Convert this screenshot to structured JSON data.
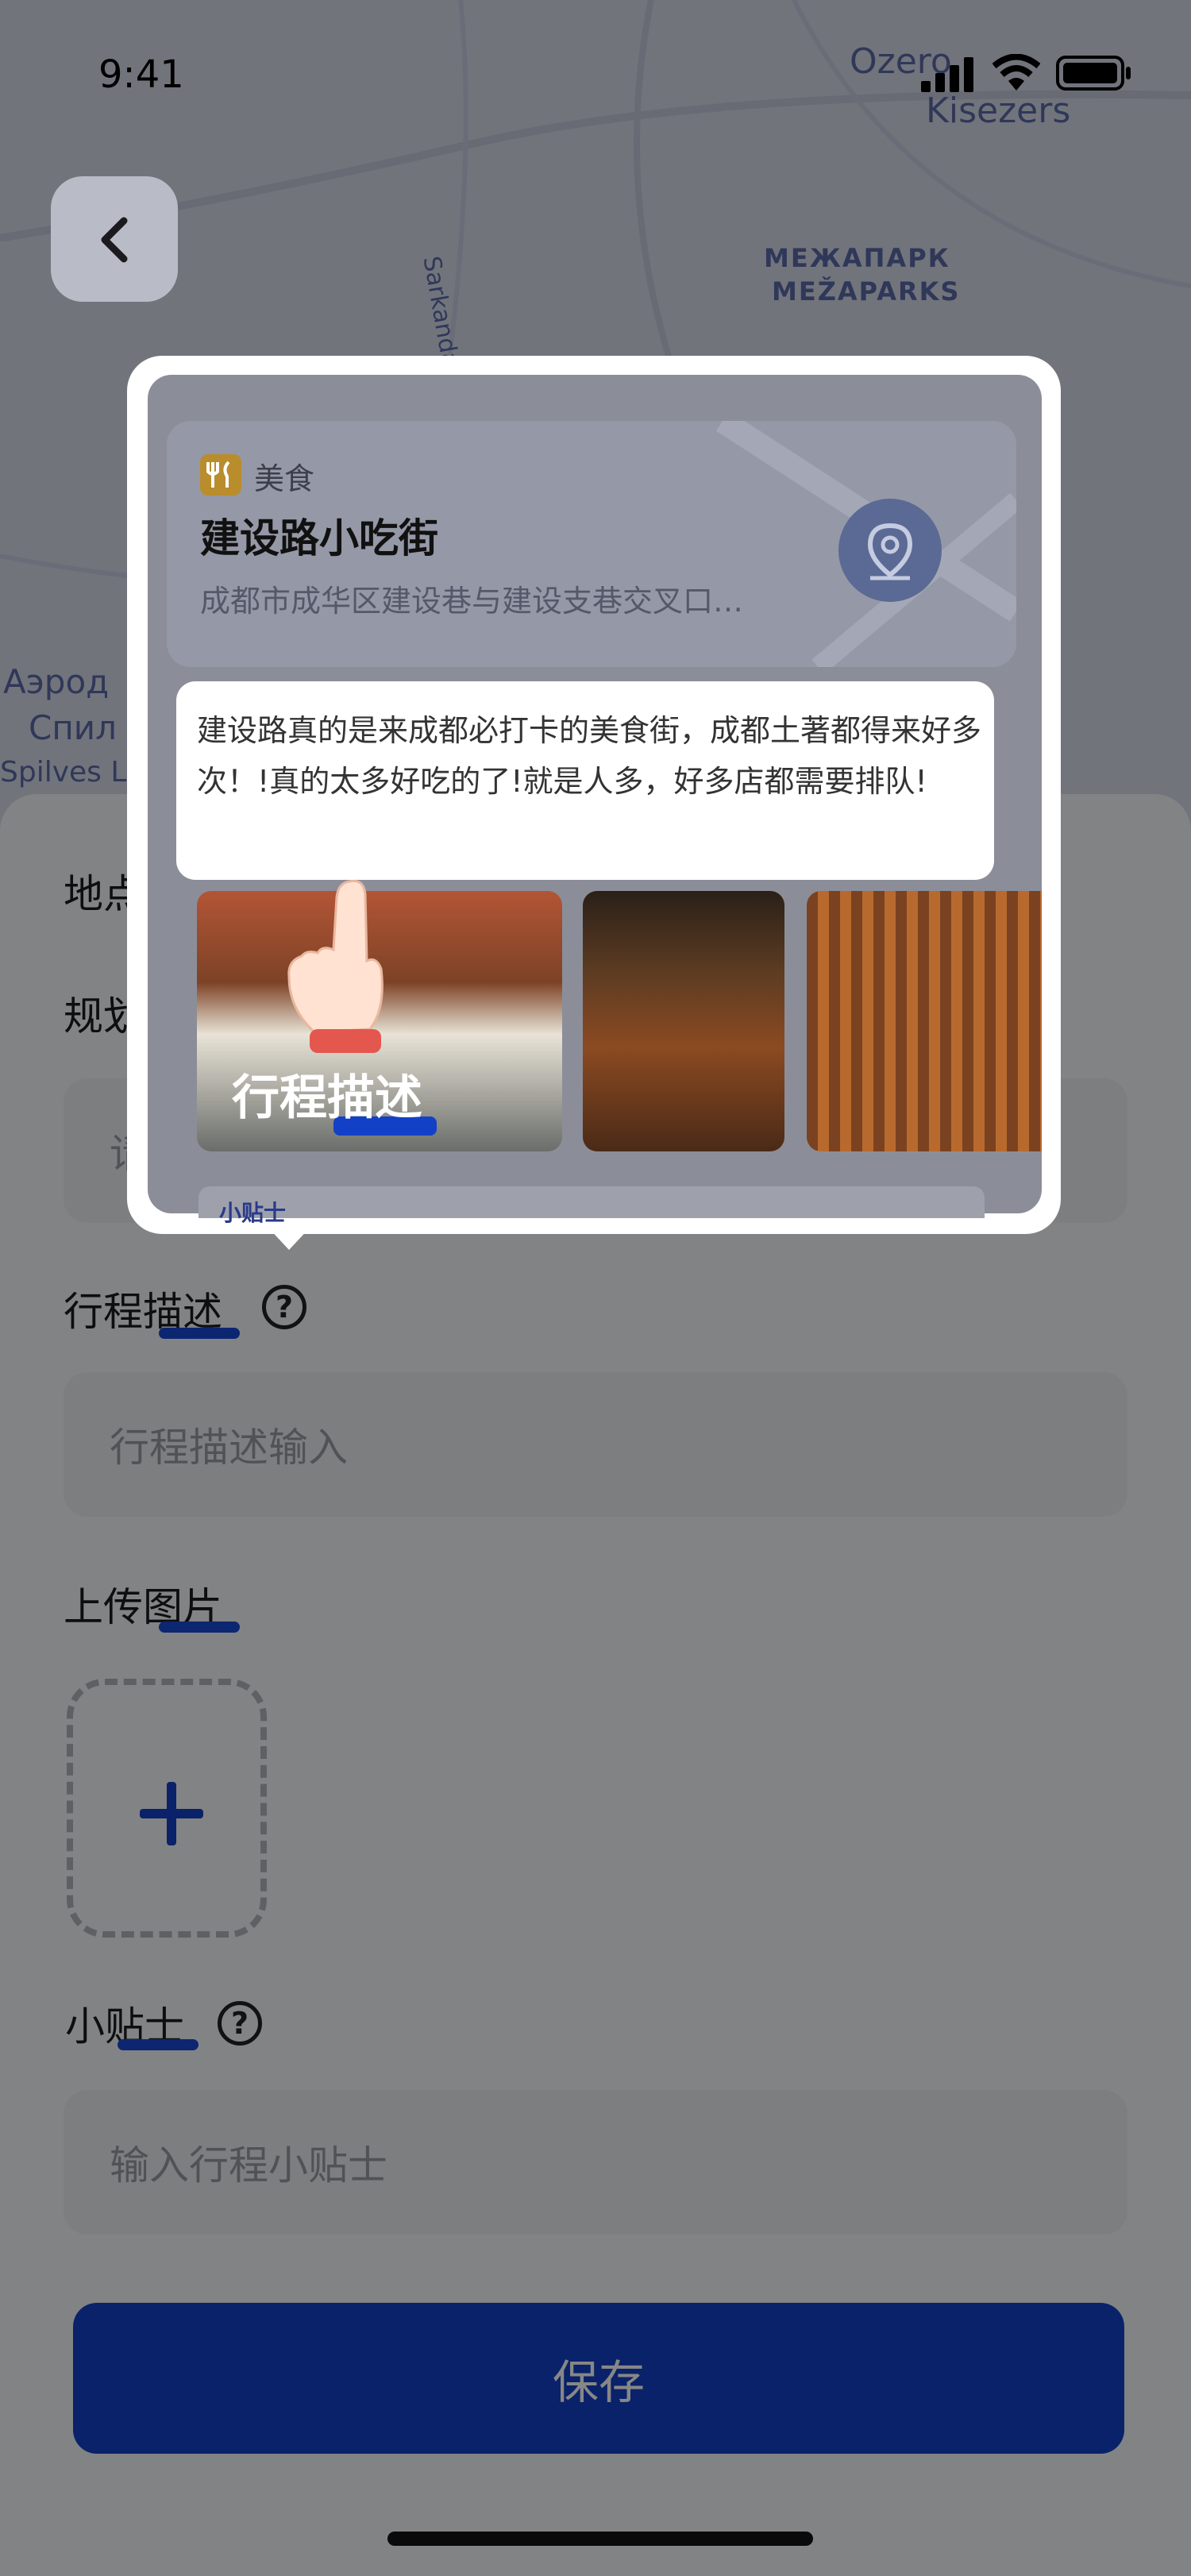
{
  "status": {
    "time": "9:41"
  },
  "map": {
    "labels": [
      "Ozero",
      "Kisezers",
      "МЕЖАПАРК",
      "MEŽAPARKS",
      "Sarkandaugava",
      "Аэрод",
      "Спил",
      "Spilves L"
    ]
  },
  "form": {
    "location_label": "地点",
    "plan_label": "规划",
    "plan_placeholder": "请",
    "description_label": "行程描述",
    "description_placeholder": "行程描述输入",
    "upload_label": "上传图片",
    "tips_label": "小贴士",
    "tips_placeholder": "输入行程小贴士",
    "save_button": "保存"
  },
  "popup": {
    "poi": {
      "category": "美食",
      "name": "建设路小吃街",
      "address": "成都市成华区建设巷与建设支巷交叉口…"
    },
    "tooltip_text": "建设路真的是来成都必打卡的美食街，成都土著都得来好多次！!真的太多好吃的了!就是人多，好多店都需要排队!",
    "highlight_label": "行程描述",
    "next_section_label": "小贴士"
  },
  "colors": {
    "accent": "#1241c7",
    "highlight": "#1a49d6",
    "category_icon": "#f4b400"
  },
  "icons": [
    "back-chevron-icon",
    "cellular-signal-icon",
    "wifi-icon",
    "battery-icon",
    "fork-knife-icon",
    "location-pin-icon",
    "question-mark-icon",
    "plus-icon",
    "pointing-hand-icon"
  ]
}
